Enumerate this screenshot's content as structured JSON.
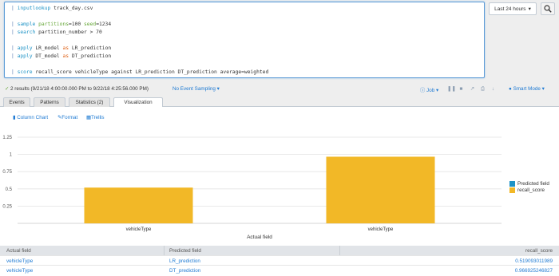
{
  "search": {
    "lines": [
      {
        "pipe": "| ",
        "cmd": "inputlookup",
        "rest": " track_day.csv"
      },
      {
        "pipe": "| ",
        "cmd": "sample",
        "arg": " partitions",
        "rest": "=100 ",
        "arg2": "seed",
        "rest2": "=1234"
      },
      {
        "pipe": "| ",
        "cmd": "search",
        "rest": " partition_number > 70"
      },
      {
        "pipe": "| ",
        "cmd": "apply",
        "rest": " LR_model ",
        "kw": "as",
        "rest2": " LR_prediction"
      },
      {
        "pipe": "| ",
        "cmd": "apply",
        "rest": " DT_model ",
        "kw": "as",
        "rest2": " DT_prediction"
      },
      {
        "pipe": "| ",
        "cmd": "score",
        "rest": " recall_score vehicleType against LR_prediction DT_prediction average=weighted"
      }
    ],
    "time_range": "Last 24 hours",
    "time_caret": "▾"
  },
  "status": {
    "check": "✓",
    "results_text": "2 results (9/21/18 4:00:00.000 PM to 9/22/18 4:25:56.000 PM)",
    "sampling": "No Event Sampling",
    "job": "Job",
    "mode": "Smart Mode",
    "caret": "▾"
  },
  "tabs": [
    {
      "label": "Events",
      "active": false
    },
    {
      "label": "Patterns",
      "active": false
    },
    {
      "label": "Statistics (2)",
      "active": false
    },
    {
      "label": "Visualization",
      "active": true
    }
  ],
  "viz_toolbar": {
    "chart_type": "Column Chart",
    "format": "Format",
    "trellis": "Trellis"
  },
  "chart_data": {
    "type": "bar",
    "categories": [
      "vehicleType",
      "vehicleType"
    ],
    "series": [
      {
        "name": "Predicted field",
        "color": "#1e93c6",
        "values": [
          null,
          null
        ]
      },
      {
        "name": "recall_score",
        "color": "#f2b827",
        "values": [
          0.519,
          0.9669
        ]
      }
    ],
    "yticks": [
      "0.25",
      "0.5",
      "0.75",
      "1",
      "1.25"
    ],
    "ylim": [
      0,
      1.25
    ],
    "xlabel": "Actual field",
    "ylabel": "",
    "legend": "right"
  },
  "table": {
    "headers": [
      "Actual field",
      "Predicted field",
      "recall_score"
    ],
    "rows": [
      [
        "vehicleType",
        "LR_prediction",
        "0.519093011989"
      ],
      [
        "vehicleType",
        "DT_prediction",
        "0.966925246827"
      ]
    ]
  },
  "colors": {
    "accent": "#1e7ad3",
    "bar": "#f2b827",
    "predicted": "#1e93c6"
  }
}
